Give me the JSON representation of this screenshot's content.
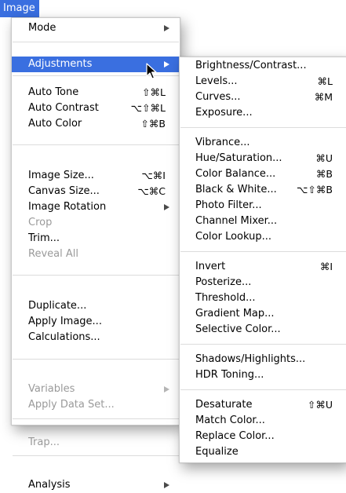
{
  "menubar": {
    "title": "Image"
  },
  "image_menu": {
    "items": [
      {
        "label": "Mode",
        "shortcut": "",
        "submenu": true,
        "enabled": true
      },
      {
        "label": "Adjustments",
        "shortcut": "",
        "submenu": true,
        "enabled": true,
        "highlighted": true
      },
      {
        "label": "Auto Tone",
        "shortcut": "⇧⌘L",
        "enabled": true
      },
      {
        "label": "Auto Contrast",
        "shortcut": "⌥⇧⌘L",
        "enabled": true
      },
      {
        "label": "Auto Color",
        "shortcut": "⇧⌘B",
        "enabled": true
      },
      {
        "label": "Image Size...",
        "shortcut": "⌥⌘I",
        "enabled": true
      },
      {
        "label": "Canvas Size...",
        "shortcut": "⌥⌘C",
        "enabled": true
      },
      {
        "label": "Image Rotation",
        "shortcut": "",
        "submenu": true,
        "enabled": true
      },
      {
        "label": "Crop",
        "shortcut": "",
        "enabled": false
      },
      {
        "label": "Trim...",
        "shortcut": "",
        "enabled": true
      },
      {
        "label": "Reveal All",
        "shortcut": "",
        "enabled": false
      },
      {
        "label": "Duplicate...",
        "shortcut": "",
        "enabled": true
      },
      {
        "label": "Apply Image...",
        "shortcut": "",
        "enabled": true
      },
      {
        "label": "Calculations...",
        "shortcut": "",
        "enabled": true
      },
      {
        "label": "Variables",
        "shortcut": "",
        "submenu": true,
        "enabled": false
      },
      {
        "label": "Apply Data Set...",
        "shortcut": "",
        "enabled": false
      },
      {
        "label": "Trap...",
        "shortcut": "",
        "enabled": false
      },
      {
        "label": "Analysis",
        "shortcut": "",
        "submenu": true,
        "enabled": true
      }
    ]
  },
  "adjustments_menu": {
    "items": [
      {
        "label": "Brightness/Contrast...",
        "shortcut": ""
      },
      {
        "label": "Levels...",
        "shortcut": "⌘L"
      },
      {
        "label": "Curves...",
        "shortcut": "⌘M"
      },
      {
        "label": "Exposure...",
        "shortcut": ""
      },
      {
        "label": "Vibrance...",
        "shortcut": ""
      },
      {
        "label": "Hue/Saturation...",
        "shortcut": "⌘U"
      },
      {
        "label": "Color Balance...",
        "shortcut": "⌘B"
      },
      {
        "label": "Black & White...",
        "shortcut": "⌥⇧⌘B"
      },
      {
        "label": "Photo Filter...",
        "shortcut": ""
      },
      {
        "label": "Channel Mixer...",
        "shortcut": ""
      },
      {
        "label": "Color Lookup...",
        "shortcut": ""
      },
      {
        "label": "Invert",
        "shortcut": "⌘I"
      },
      {
        "label": "Posterize...",
        "shortcut": ""
      },
      {
        "label": "Threshold...",
        "shortcut": ""
      },
      {
        "label": "Gradient Map...",
        "shortcut": ""
      },
      {
        "label": "Selective Color...",
        "shortcut": ""
      },
      {
        "label": "Shadows/Highlights...",
        "shortcut": ""
      },
      {
        "label": "HDR Toning...",
        "shortcut": ""
      },
      {
        "label": "Desaturate",
        "shortcut": "⇧⌘U"
      },
      {
        "label": "Match Color...",
        "shortcut": ""
      },
      {
        "label": "Replace Color...",
        "shortcut": ""
      },
      {
        "label": "Equalize",
        "shortcut": ""
      }
    ]
  },
  "colors": {
    "highlight": "#3a6fe0",
    "disabled_text": "#9a9a9a"
  },
  "cursor": {
    "icon": "arrow-cursor-icon"
  }
}
